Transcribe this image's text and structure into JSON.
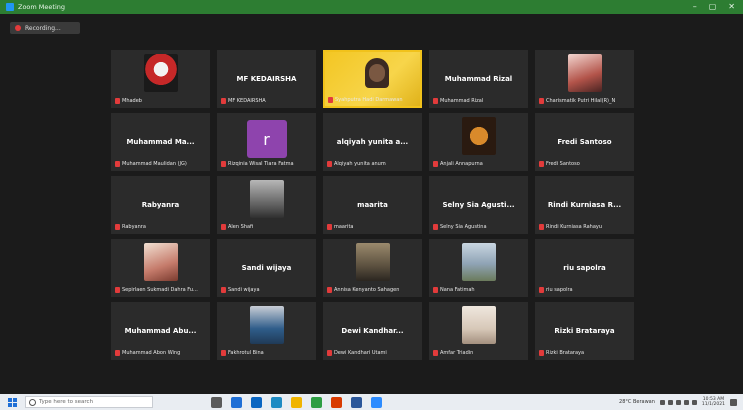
{
  "window": {
    "title": "Zoom Meeting"
  },
  "recording": {
    "label": "Recording..."
  },
  "participants": [
    {
      "display": "",
      "label": "Mhadeb",
      "kind": "image",
      "img": "red"
    },
    {
      "display": "MF KEDAIRSHA",
      "label": "MF KEDAIRSHA",
      "kind": "name"
    },
    {
      "display": "",
      "label": "Syahputra Hadi Darmawan",
      "kind": "video"
    },
    {
      "display": "Muhammad Rizal",
      "label": "Muhammad Rizal",
      "kind": "name"
    },
    {
      "display": "",
      "label": "Charismatik Putri Hilal(R)_N",
      "kind": "image",
      "img": "pink"
    },
    {
      "display": "Muhammad Ma...",
      "label": "Muhammad Maulidan (JG)",
      "kind": "name"
    },
    {
      "display": "",
      "label": "Rizqinia Wisal Tiara Fatma",
      "kind": "letter",
      "letter": "r"
    },
    {
      "display": "alqiyah yunita a...",
      "label": "Alqiyah yunita anum",
      "kind": "name"
    },
    {
      "display": "",
      "label": "Anjali Annapurna",
      "kind": "image",
      "img": "orange"
    },
    {
      "display": "Fredi Santoso",
      "label": "Fredi Santoso",
      "kind": "name"
    },
    {
      "display": "Rabyanra",
      "label": "Rabyanra",
      "kind": "name"
    },
    {
      "display": "",
      "label": "Alen Shafi",
      "kind": "image",
      "img": "grey"
    },
    {
      "display": "maarita",
      "label": "maarita",
      "kind": "name"
    },
    {
      "display": "Selny Sia Agusti...",
      "label": "Selny Sia Agustina",
      "kind": "name"
    },
    {
      "display": "Rindi Kurniasa R...",
      "label": "Rindi Kurniasa Rahayu",
      "kind": "name"
    },
    {
      "display": "",
      "label": "Sepirlaen Sukmadi Dahra Fu...",
      "kind": "image",
      "img": "beige"
    },
    {
      "display": "Sandi wijaya",
      "label": "Sandi wijaya",
      "kind": "name"
    },
    {
      "display": "",
      "label": "Annisa Kenyanto Sahagen",
      "kind": "image",
      "img": "sand"
    },
    {
      "display": "",
      "label": "Nana Fatimah",
      "kind": "image",
      "img": "outdoor"
    },
    {
      "display": "riu sapolra",
      "label": "riu sapolra",
      "kind": "name"
    },
    {
      "display": "Muhammad Abu...",
      "label": "Muhammad Abon Wing",
      "kind": "name"
    },
    {
      "display": "",
      "label": "Fakhrotul Bina",
      "kind": "image",
      "img": "blue"
    },
    {
      "display": "Dewi Kandhar...",
      "label": "Dewi Kandhari Utami",
      "kind": "name"
    },
    {
      "display": "",
      "label": "Amfar Triadin",
      "kind": "image",
      "img": "light"
    },
    {
      "display": "Rizki Brataraya",
      "label": "Rizki Brataraya",
      "kind": "name"
    }
  ],
  "taskbar": {
    "search_placeholder": "Type here to search",
    "weather": "28°C Berawan",
    "time": "10:53 AM",
    "date": "11/1/2021"
  },
  "colors": {
    "titlebar": "#2d7d32",
    "active_border": "#f1c21b",
    "tile_bg": "#2b2b2b",
    "stage_bg": "#1b1b1b"
  }
}
